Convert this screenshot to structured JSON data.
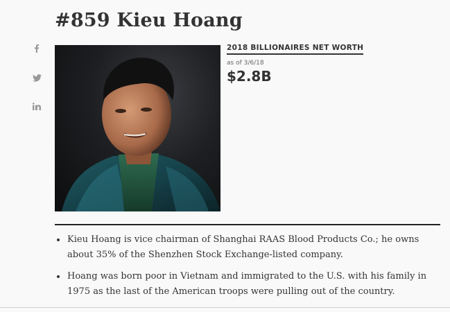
{
  "profile": {
    "rank_name": "#859 Kieu Hoang",
    "photo_alt": "Kieu Hoang"
  },
  "share": {
    "icons": [
      "facebook-icon",
      "twitter-icon",
      "linkedin-icon"
    ],
    "facebook_glyph": "f",
    "twitter_glyph": "",
    "linkedin_glyph": "in"
  },
  "net_worth": {
    "label": "2018 BILLIONAIRES NET WORTH",
    "as_of": "as of 3/6/18",
    "value": "$2.8B"
  },
  "bio": {
    "bullets": [
      "Kieu Hoang is vice chairman of Shanghai RAAS Blood Products Co.; he owns about 35% of the Shenzhen Stock Exchange-listed company.",
      "Hoang was born poor in Vietnam and immigrated to the U.S. with his family in 1975 as the last of the American troops were pulling out of the country."
    ]
  },
  "colors": {
    "background": "#f9f9f9",
    "text": "#333333",
    "share_icon": "#9a9a9a",
    "divider": "#222222"
  }
}
